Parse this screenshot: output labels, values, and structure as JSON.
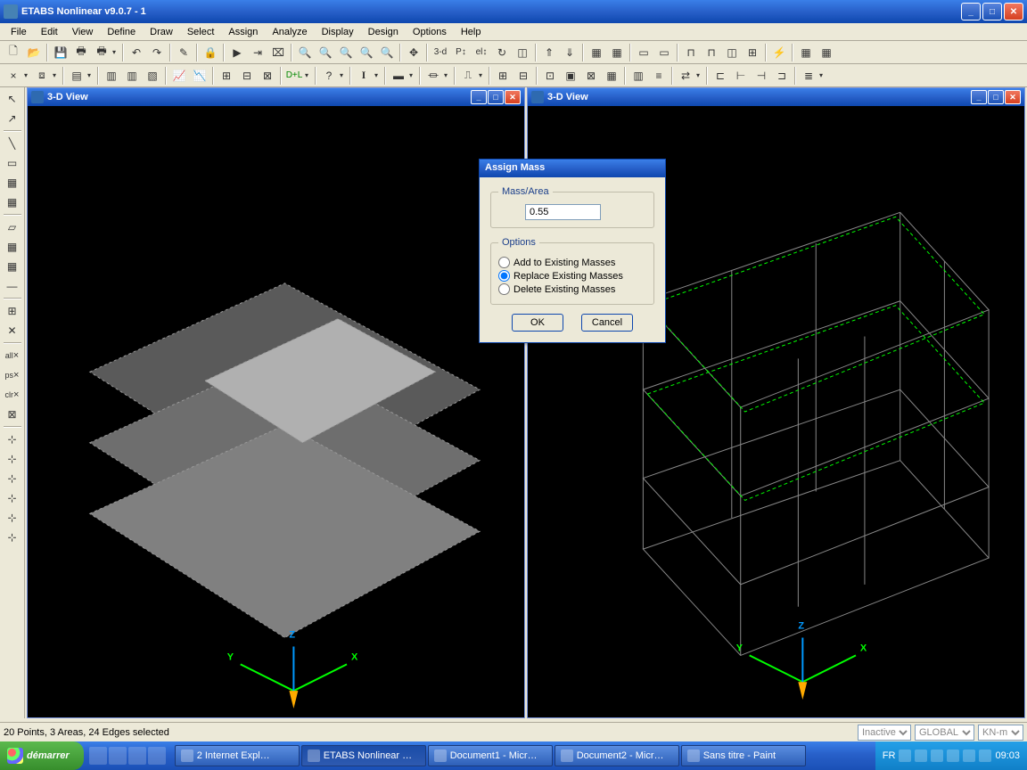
{
  "titlebar": {
    "title": "ETABS Nonlinear v9.0.7 - 1"
  },
  "menu": [
    "File",
    "Edit",
    "View",
    "Define",
    "Draw",
    "Select",
    "Assign",
    "Analyze",
    "Display",
    "Design",
    "Options",
    "Help"
  ],
  "views": {
    "left": "3-D View",
    "right": "3-D View"
  },
  "dialog": {
    "title": "Assign Mass",
    "mass_area_label": "Mass/Area",
    "mass_value": "0.55",
    "options_label": "Options",
    "opt_add": "Add to Existing Masses",
    "opt_replace": "Replace Existing Masses",
    "opt_delete": "Delete Existing Masses",
    "ok": "OK",
    "cancel": "Cancel"
  },
  "status": {
    "selection": "20 Points, 3 Areas, 24 Edges selected",
    "drop1": "Inactive",
    "drop2": "GLOBAL",
    "drop3": "KN-m"
  },
  "taskbar": {
    "start": "démarrer",
    "tasks": [
      "2 Internet Expl…",
      "ETABS Nonlinear …",
      "Document1 - Micr…",
      "Document2 - Micr…",
      "Sans titre - Paint"
    ],
    "lang": "FR",
    "time": "09:03"
  },
  "axes": {
    "x": "X",
    "y": "Y",
    "z": "Z"
  }
}
